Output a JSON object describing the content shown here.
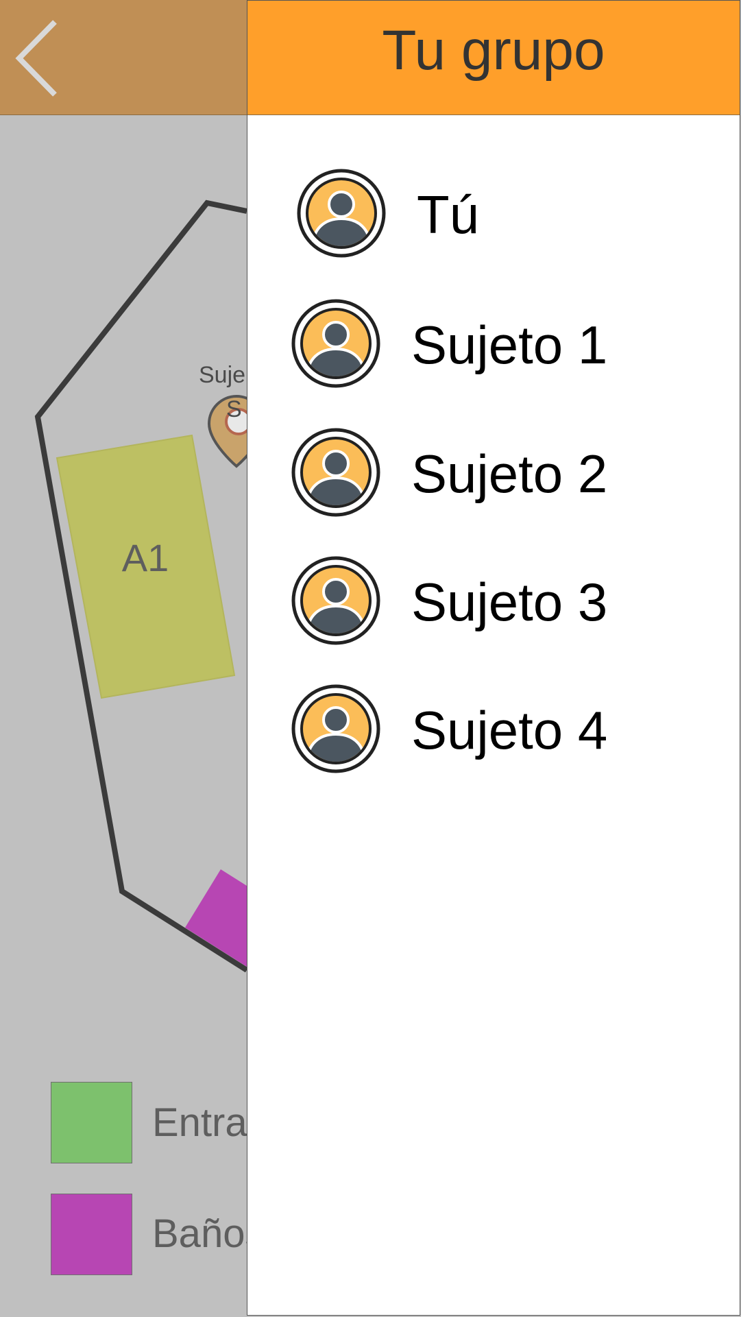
{
  "background_screen": {
    "map": {
      "area_label": "A1",
      "marker_label": "Suje",
      "marker_sub_label": "S"
    },
    "legend": [
      {
        "label": "Entrad",
        "color": "#7dc16d"
      },
      {
        "label": "Baños",
        "color": "#b746b3"
      }
    ],
    "colors": {
      "topbar": "#c08f55",
      "area_fill": "#bdc063",
      "wall": "#3b3b3b"
    }
  },
  "drawer": {
    "title": "Tu grupo",
    "header_color": "#ff9f2a",
    "members": [
      {
        "name": "Tú",
        "icon": "user-avatar-icon"
      },
      {
        "name": "Sujeto 1",
        "icon": "user-avatar-icon"
      },
      {
        "name": "Sujeto 2",
        "icon": "user-avatar-icon"
      },
      {
        "name": "Sujeto 3",
        "icon": "user-avatar-icon"
      },
      {
        "name": "Sujeto 4",
        "icon": "user-avatar-icon"
      }
    ]
  }
}
